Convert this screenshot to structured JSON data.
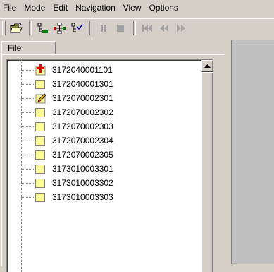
{
  "menu": {
    "items": [
      {
        "label": "File"
      },
      {
        "label": "Mode"
      },
      {
        "label": "Edit"
      },
      {
        "label": "Navigation"
      },
      {
        "label": "View"
      },
      {
        "label": "Options"
      }
    ]
  },
  "toolbar": {
    "buttons": [
      {
        "icon": "open-folder-icon"
      },
      {
        "icon": "tree-collapse-icon"
      },
      {
        "icon": "tree-network-icon"
      },
      {
        "icon": "tree-check-icon"
      },
      {
        "icon": "pause-icon"
      },
      {
        "icon": "stop-icon"
      },
      {
        "icon": "first-icon"
      },
      {
        "icon": "rewind-icon"
      },
      {
        "icon": "fast-forward-icon"
      }
    ]
  },
  "left_panel": {
    "tab_label": "File",
    "tree": {
      "items": [
        {
          "label": "3172040001101",
          "icon": "red-plus-icon"
        },
        {
          "label": "3172040001301",
          "icon": "yellow-square-icon"
        },
        {
          "label": "3172070002301",
          "icon": "pencil-icon"
        },
        {
          "label": "3172070002302",
          "icon": "yellow-square-icon"
        },
        {
          "label": "3172070002303",
          "icon": "yellow-square-icon"
        },
        {
          "label": "3172070002304",
          "icon": "yellow-square-icon"
        },
        {
          "label": "3172070002305",
          "icon": "yellow-square-icon"
        },
        {
          "label": "3173010003301",
          "icon": "yellow-square-icon"
        },
        {
          "label": "3173010003302",
          "icon": "yellow-square-icon"
        },
        {
          "label": "3173010003303",
          "icon": "yellow-square-icon"
        }
      ]
    }
  },
  "colors": {
    "window_bg": "#d4d0c8",
    "tree_bg": "#ffffff",
    "node_yellow": "#ffff99",
    "right_panel_bg": "#c0c0c0"
  }
}
